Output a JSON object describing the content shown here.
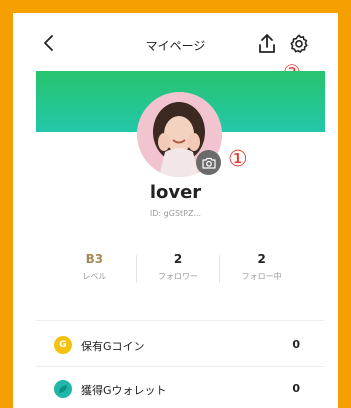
{
  "header": {
    "title": "マイページ",
    "annotation_settings": "②"
  },
  "profile": {
    "username": "lover",
    "user_id": "ID: gGStPZ...",
    "annotation_camera": "①"
  },
  "stats": [
    {
      "value": "B3",
      "label": "レベル"
    },
    {
      "value": "2",
      "label": "フォロワー"
    },
    {
      "value": "2",
      "label": "フォロー中"
    }
  ],
  "wallet": [
    {
      "icon": "g-coin-icon",
      "label": "保有Gコイン",
      "value": "0",
      "color": "#f4c10f"
    },
    {
      "icon": "wallet-icon",
      "label": "獲得Gウォレット",
      "value": "0",
      "color": "#1fb7a8"
    }
  ],
  "colors": {
    "frame": "#f5a000",
    "banner_top": "#27c46e",
    "banner_bottom": "#23c7a9",
    "annotation": "#e53935",
    "level_text": "#a58a55"
  }
}
